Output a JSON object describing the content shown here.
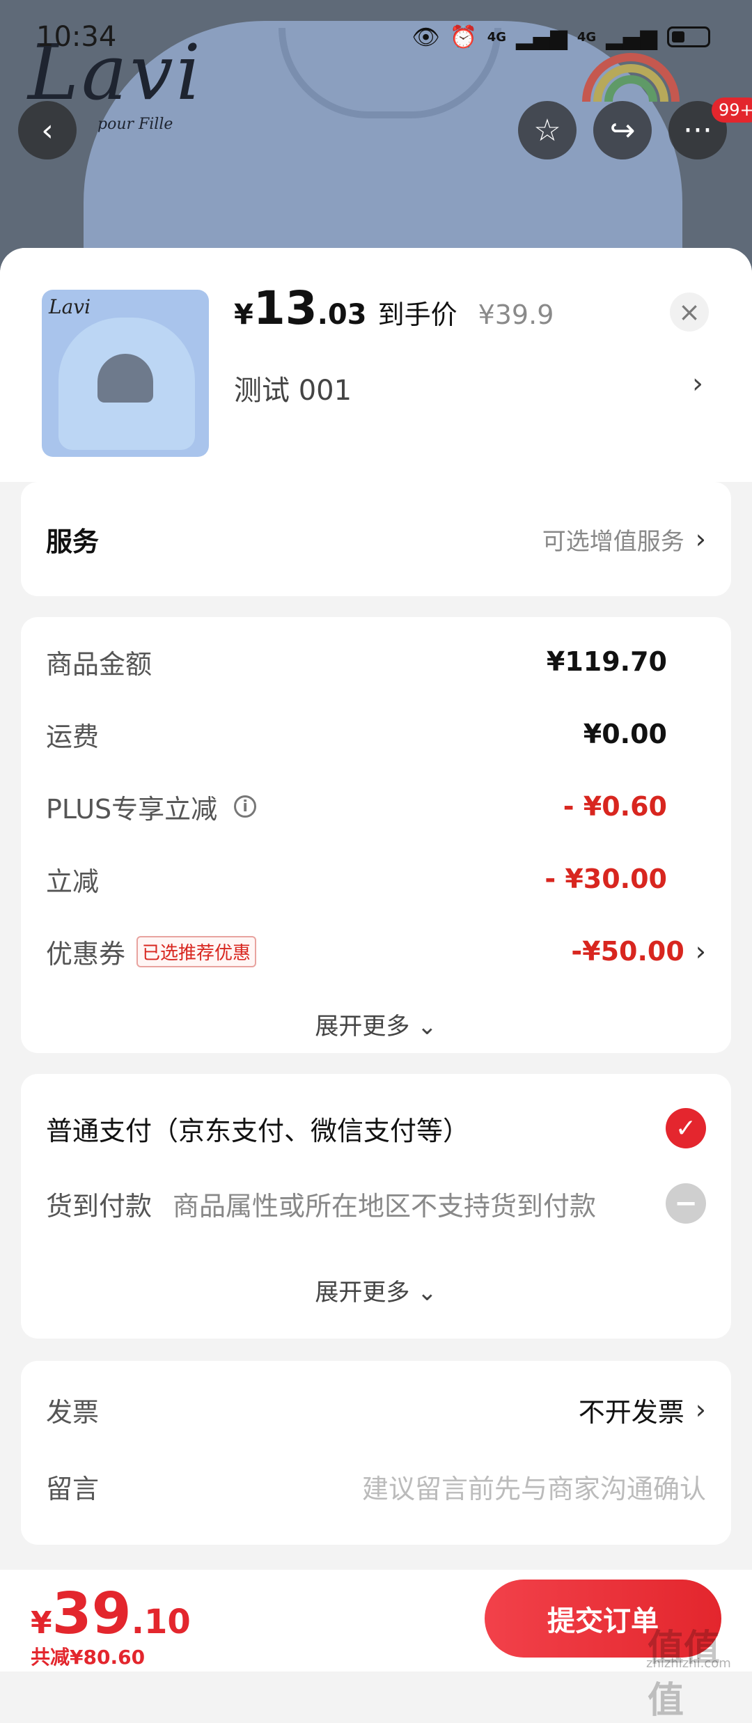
{
  "status_bar": {
    "time": "10:34",
    "network1": "4G",
    "network2": "4G"
  },
  "background": {
    "brand": "Lavi",
    "brand_sub": "pour Fille"
  },
  "nav": {
    "badge": "99+"
  },
  "product": {
    "price_symbol": "¥",
    "price_int": "13",
    "price_dec": ".03",
    "price_tag": "到手价",
    "original_price": "¥39.9",
    "variant": "测试  001",
    "thumb_brand": "Lavi"
  },
  "service": {
    "label": "服务",
    "value": "可选增值服务"
  },
  "amounts": {
    "goods_label": "商品金额",
    "goods_value": "¥119.70",
    "shipping_label": "运费",
    "shipping_value": "¥0.00",
    "plus_label": "PLUS专享立减",
    "plus_value": "- ¥0.60",
    "discount_label": "立减",
    "discount_value": "- ¥30.00",
    "coupon_label": "优惠券",
    "coupon_tag": "已选推荐优惠",
    "coupon_value": "-¥50.00",
    "expand_more": "展开更多"
  },
  "payment": {
    "normal_label": "普通支付（京东支付、微信支付等）",
    "cod_label": "货到付款",
    "cod_note": "商品属性或所在地区不支持货到付款",
    "expand_more": "展开更多"
  },
  "invoice": {
    "invoice_label": "发票",
    "invoice_value": "不开发票",
    "message_label": "留言",
    "message_placeholder": "建议留言前先与商家沟通确认"
  },
  "bottom": {
    "total_symbol": "¥",
    "total_int": "39",
    "total_dec": ".10",
    "saved": "共减¥80.60",
    "submit": "提交订单",
    "watermark": "值值值",
    "watermark_sub": "zhizhizhi.com"
  },
  "colors": {
    "accent_red": "#e3262d",
    "price_red": "#d8261f"
  }
}
